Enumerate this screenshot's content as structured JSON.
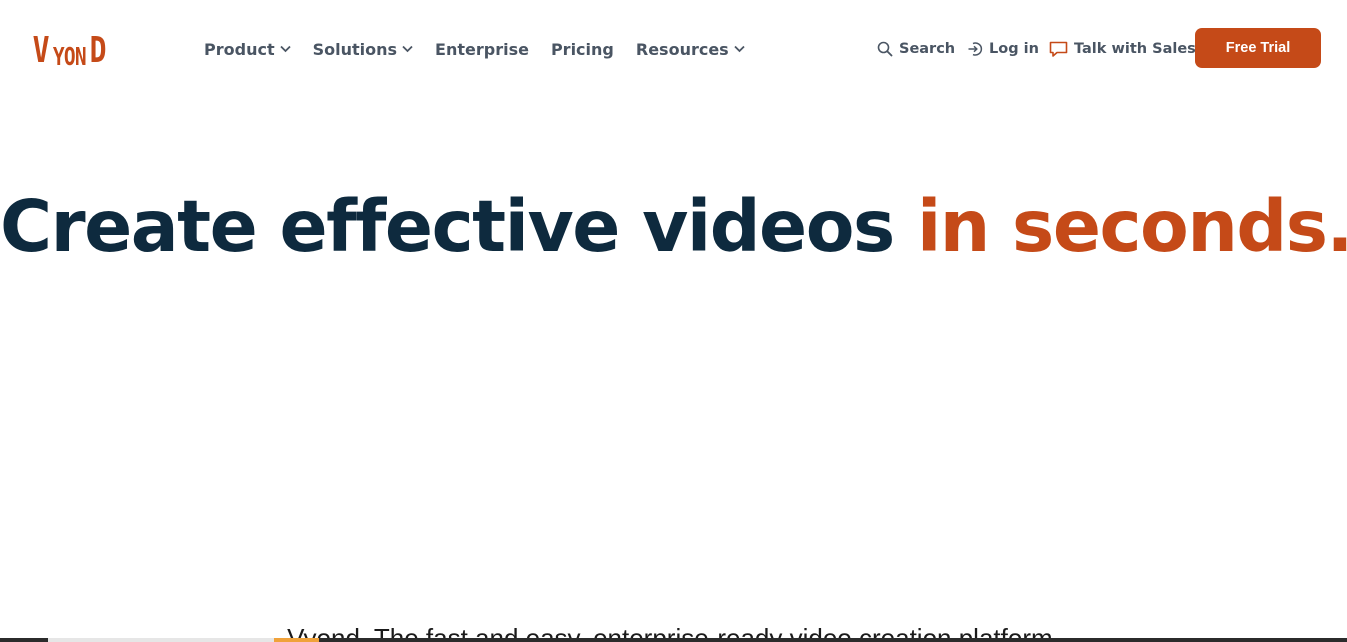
{
  "brand": {
    "logo_letters": [
      "V",
      "Y",
      "O",
      "N",
      "D"
    ],
    "accent_color": "#c54a18",
    "text_color": "#0e2a3e"
  },
  "nav": {
    "items": [
      {
        "label": "Product",
        "has_dropdown": true
      },
      {
        "label": "Solutions",
        "has_dropdown": true
      },
      {
        "label": "Enterprise",
        "has_dropdown": false
      },
      {
        "label": "Pricing",
        "has_dropdown": false
      },
      {
        "label": "Resources",
        "has_dropdown": true
      }
    ]
  },
  "utility": {
    "search_label": "Search",
    "search_icon": "search-icon",
    "login_label": "Log in",
    "login_icon": "login-icon",
    "sales_label": "Talk with Sales",
    "sales_icon": "chat-bubble-icon"
  },
  "cta": {
    "free_trial_label": "Free Trial"
  },
  "hero": {
    "title_main": "Create effective videos ",
    "title_accent": "in seconds.",
    "subtitle": "Vyond. The fast and easy, enterprise-ready video creation platform."
  }
}
